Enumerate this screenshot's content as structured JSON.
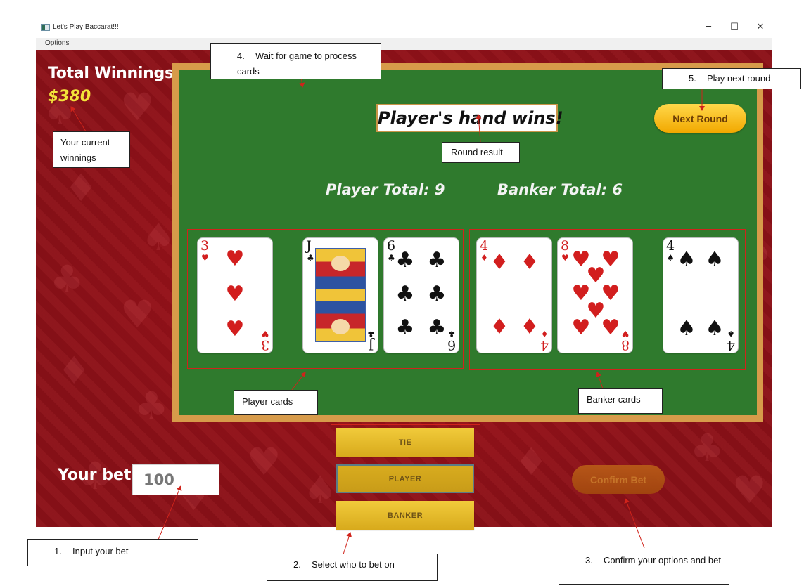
{
  "window": {
    "title": "Let's Play Baccarat!!!",
    "minimize": "─",
    "maximize": "☐",
    "close": "✕"
  },
  "menu": {
    "options_label": "Options"
  },
  "winnings": {
    "label": "Total Winnings:",
    "value": "$380"
  },
  "round": {
    "result": "Player's hand wins!",
    "player_total": "Player Total: 9",
    "banker_total": "Banker Total: 6",
    "next_round_label": "Next Round"
  },
  "player_cards": [
    {
      "rank": "3",
      "suit": "♥",
      "color": "red"
    },
    {
      "rank": "J",
      "suit": "♣",
      "color": "black"
    },
    {
      "rank": "6",
      "suit": "♣",
      "color": "black"
    }
  ],
  "banker_cards": [
    {
      "rank": "4",
      "suit": "♦",
      "color": "red"
    },
    {
      "rank": "8",
      "suit": "♥",
      "color": "red"
    },
    {
      "rank": "4",
      "suit": "♠",
      "color": "black"
    }
  ],
  "bet": {
    "label": "Your bet:",
    "input_value": "100",
    "options": [
      "TIE",
      "PLAYER",
      "BANKER"
    ],
    "selected": "PLAYER",
    "confirm_label": "Confirm Bet"
  },
  "annotations": {
    "current_winnings": "Your current winnings",
    "round_result": "Round result",
    "player_cards": "Player cards",
    "banker_cards": "Banker cards",
    "step1_num": "1.",
    "step1": "Input your bet",
    "step2_num": "2.",
    "step2": "Select who to bet on",
    "step3_num": "3.",
    "step3": "Confirm your options and bet",
    "step4_num": "4.",
    "step4": "Wait for game to process cards",
    "step5_num": "5.",
    "step5": "Play next round"
  },
  "colors": {
    "felt": "#2f7a2d",
    "table_border": "#d79b4a",
    "background": "#8c1118",
    "gold": "#f3e33a",
    "annotation_arrow": "#d0231b"
  }
}
